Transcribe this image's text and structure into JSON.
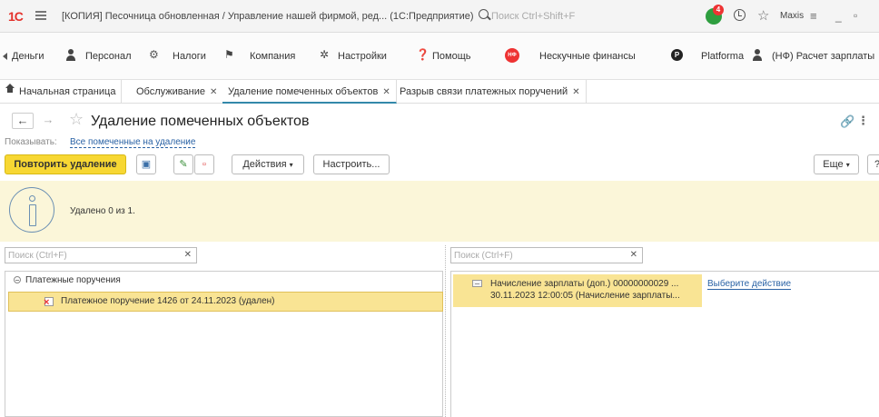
{
  "titlebar": {
    "logo": "1С",
    "title": "[КОПИЯ] Песочница обновленная / Управление нашей фирмой, ред... (1С:Предприятие)",
    "search_placeholder": "Поиск Ctrl+Shift+F",
    "notif_count": "4",
    "user": "Maxis"
  },
  "sections": {
    "money": "Деньги",
    "personnel": "Персонал",
    "taxes": "Налоги",
    "company": "Компания",
    "settings": "Настройки",
    "help": "Помощь",
    "nf_logo": "НФ",
    "nf": "Нескучные финансы",
    "platform_logo": "P",
    "platform": "Platforma",
    "payroll": "(НФ) Расчет зарплаты"
  },
  "tabs": [
    {
      "label": "Начальная страница"
    },
    {
      "label": "Обслуживание"
    },
    {
      "label": "Удаление помеченных объектов"
    },
    {
      "label": "Разрыв связи платежных поручений"
    }
  ],
  "form": {
    "title": "Удаление помеченных объектов",
    "show_label": "Показывать:",
    "show_value": "Все помеченные на удаление"
  },
  "toolbar": {
    "repeat_label": "Повторить удаление",
    "actions_label": "Действия",
    "setup_label": "Настроить...",
    "more_label": "Еще",
    "help_label": "?"
  },
  "info": {
    "text": "Удалено 0 из 1."
  },
  "left_panel": {
    "search_placeholder": "Поиск (Ctrl+F)",
    "group": "Платежные поручения",
    "item": "Платежное поручение 1426 от 24.11.2023 (удален)"
  },
  "right_panel": {
    "search_placeholder": "Поиск (Ctrl+F)",
    "row_line1": "Начисление зарплаты (доп.) 00000000029 ...",
    "row_line2": "30.11.2023 12:00:05 (Начисление зарплаты...",
    "action": "Выберите действие"
  },
  "colors": {
    "primary_button": "#f7d733",
    "selection": "#f9e494",
    "info_background": "#fbf6d9",
    "link": "#2a62a5"
  }
}
